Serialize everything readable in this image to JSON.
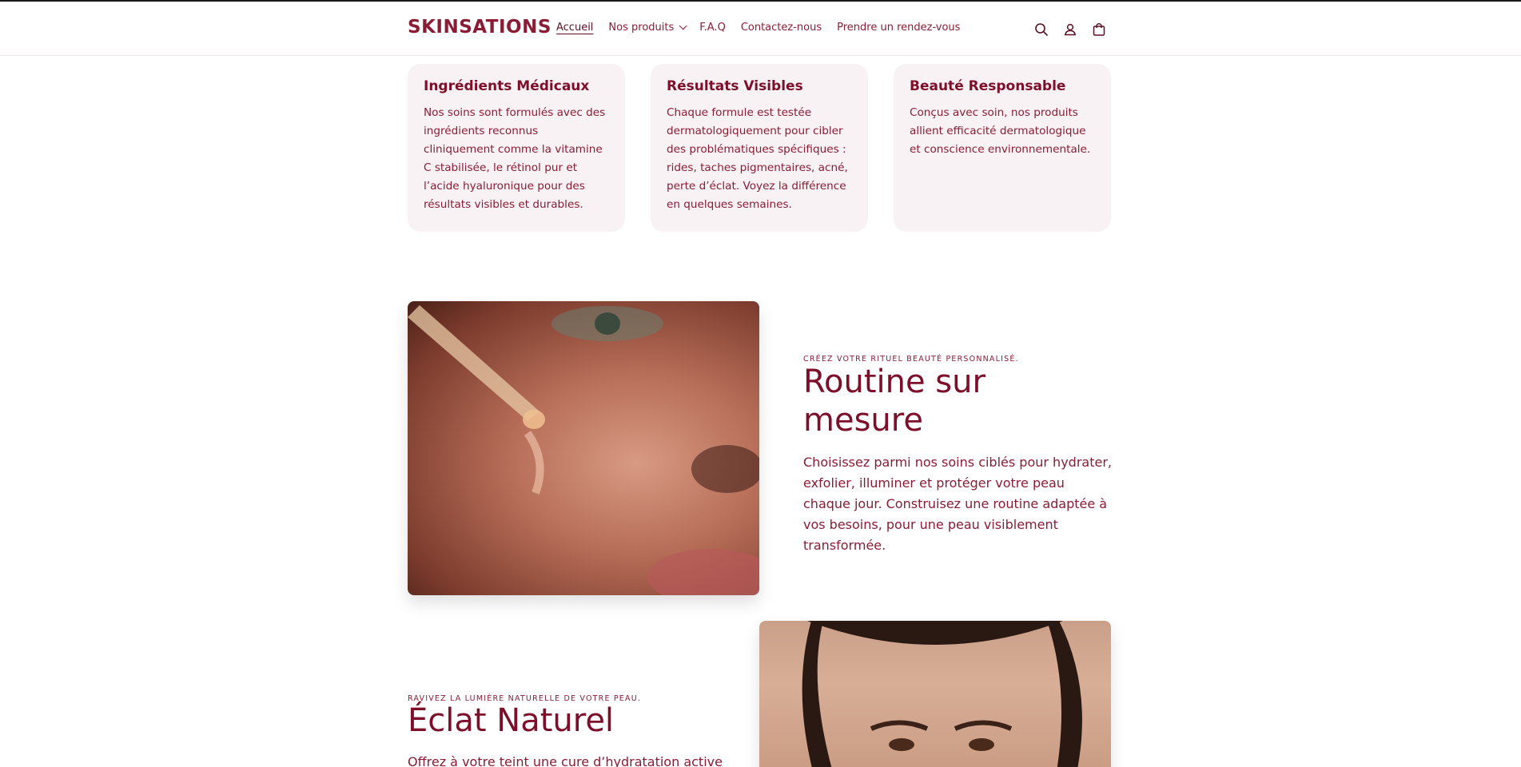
{
  "header": {
    "logo": "SKINSATIONS",
    "nav": [
      {
        "label": "Accueil",
        "active": true
      },
      {
        "label": "Nos produits",
        "dropdown": true
      },
      {
        "label": "F.A.Q"
      },
      {
        "label": "Contactez-nous"
      },
      {
        "label": "Prendre un rendez-vous"
      }
    ],
    "icons": [
      "search-icon",
      "account-icon",
      "cart-icon"
    ]
  },
  "features": [
    {
      "title": "Ingrédients Médicaux",
      "text": "Nos soins sont formulés avec des ingrédients reconnus cliniquement comme la vitamine C stabilisée, le rétinol pur et l’acide hyaluronique pour des résultats visibles et durables."
    },
    {
      "title": "Résultats Visibles",
      "text": "Chaque formule est testée dermatologiquement pour cibler des problématiques spécifiques : rides, taches pigmentaires, acné, perte d’éclat. Voyez la différence en quelques semaines."
    },
    {
      "title": "Beauté Responsable",
      "text": "Conçus avec soin, nos produits allient efficacité dermatologique et conscience environnementale."
    }
  ],
  "routine": {
    "eyebrow": "CRÉEZ VOTRE RITUEL BEAUTÉ PERSONNALISÉ.",
    "title": "Routine sur mesure",
    "text": "Choisissez parmi nos soins ciblés pour hydrater, exfolier, illuminer et protéger votre peau chaque jour. Construisez une routine adaptée à vos besoins, pour une peau visiblement transformée."
  },
  "eclat": {
    "eyebrow": "RAVIVEZ LA LUMIÈRE NATURELLE DE VOTRE PEAU.",
    "title": "Éclat Naturel",
    "text": "Offrez à votre teint une cure d’hydratation active"
  },
  "colors": {
    "brand": "#8a1c36",
    "card_bg": "#f9f2f4"
  }
}
